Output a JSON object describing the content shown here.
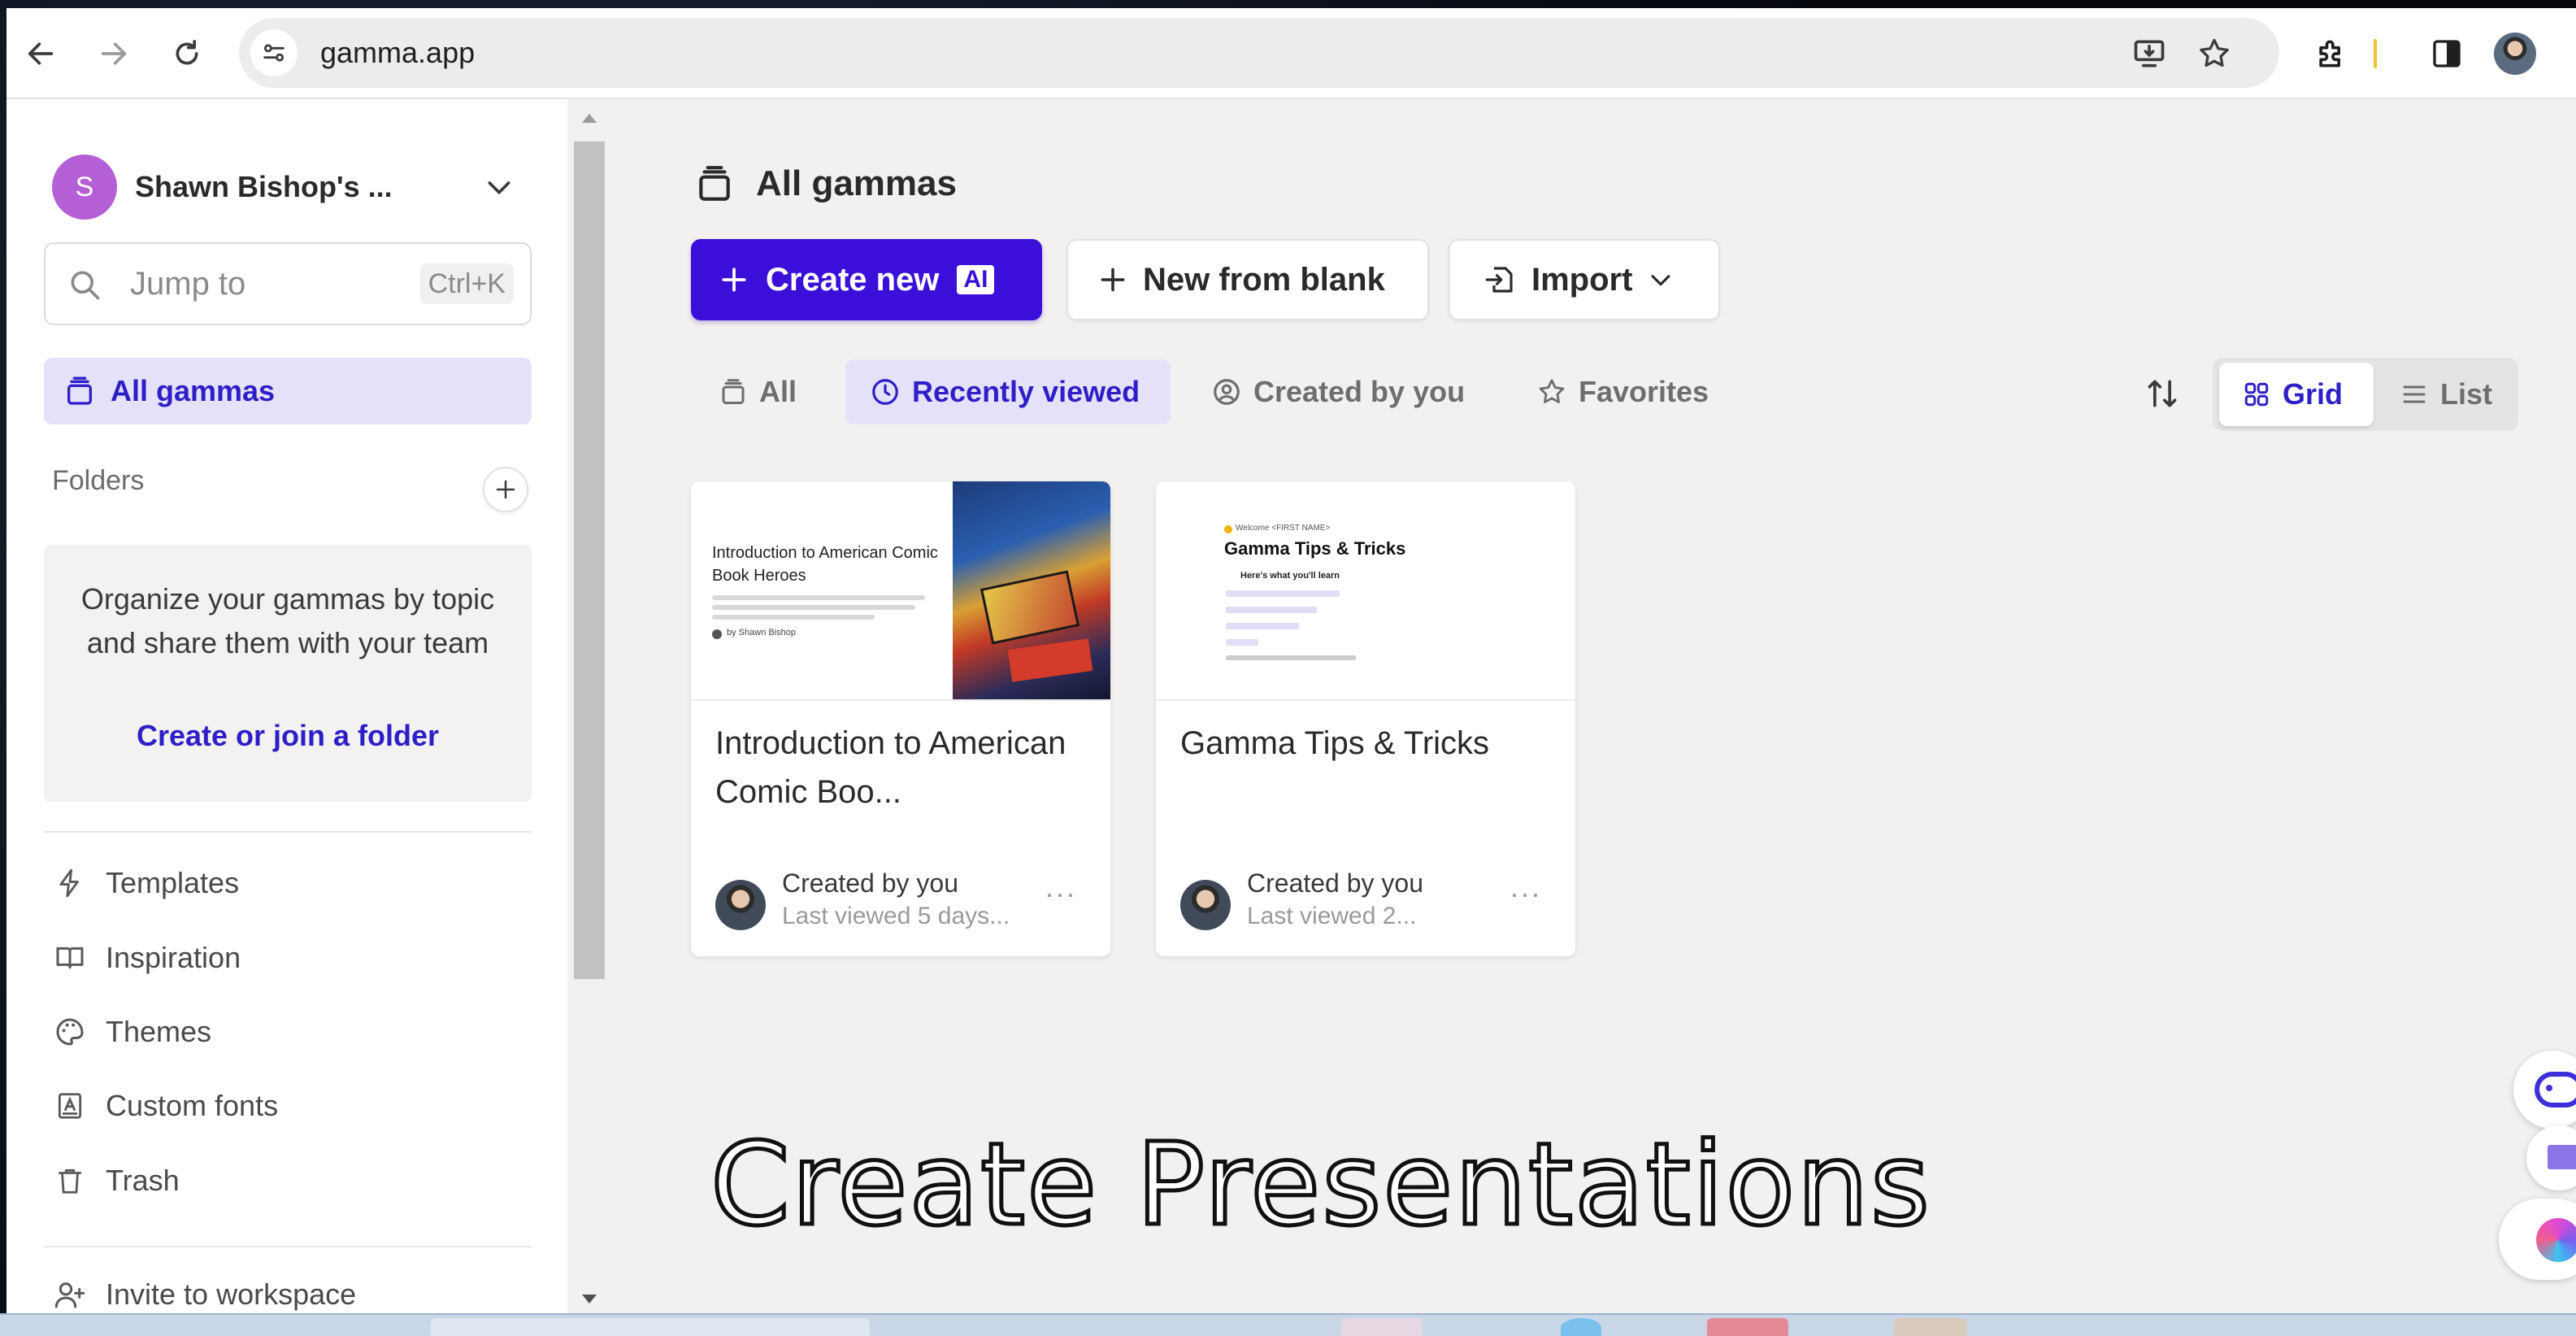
{
  "browser": {
    "url": "gamma.app"
  },
  "sidebar": {
    "workspace": {
      "initial": "S",
      "name": "Shawn Bishop's ..."
    },
    "search": {
      "placeholder": "Jump to",
      "shortcut": "Ctrl+K"
    },
    "active_item": "All gammas",
    "folders": {
      "header": "Folders",
      "empty_text": "Organize your gammas by topic and share them with your team",
      "cta": "Create or join a folder"
    },
    "items": [
      {
        "label": "Templates",
        "icon": "lightning-icon"
      },
      {
        "label": "Inspiration",
        "icon": "book-icon"
      },
      {
        "label": "Themes",
        "icon": "palette-icon"
      },
      {
        "label": "Custom fonts",
        "icon": "font-icon"
      },
      {
        "label": "Trash",
        "icon": "trash-icon"
      }
    ],
    "invite": "Invite to workspace"
  },
  "main": {
    "title": "All gammas",
    "actions": {
      "create_new": "Create new",
      "ai_badge": "AI",
      "new_from_blank": "New from blank",
      "import": "Import"
    },
    "filters": [
      "All",
      "Recently viewed",
      "Created by you",
      "Favorites"
    ],
    "active_filter": "Recently viewed",
    "view": {
      "grid": "Grid",
      "list": "List",
      "active": "Grid"
    },
    "cards": [
      {
        "title": "Introduction to American Comic Boo...",
        "created": "Created by you",
        "viewed": "Last viewed 5 days...",
        "thumb_title": "Introduction to American Comic Book Heroes",
        "thumb_author": "by Shawn Bishop"
      },
      {
        "title": "Gamma Tips & Tricks",
        "created": "Created by you",
        "viewed": "Last viewed 2...",
        "thumb_kicker": "Welcome <FIRST NAME>",
        "thumb_title": "Gamma Tips & Tricks",
        "thumb_sub": "Here's what you'll learn"
      }
    ]
  },
  "overlay": {
    "caption": "Create Presentations"
  },
  "colors": {
    "accent": "#3b0fd9",
    "accent_text": "#2d1fc8",
    "active_bg": "#e6e1fb",
    "app_bg": "#f3f1ef"
  }
}
